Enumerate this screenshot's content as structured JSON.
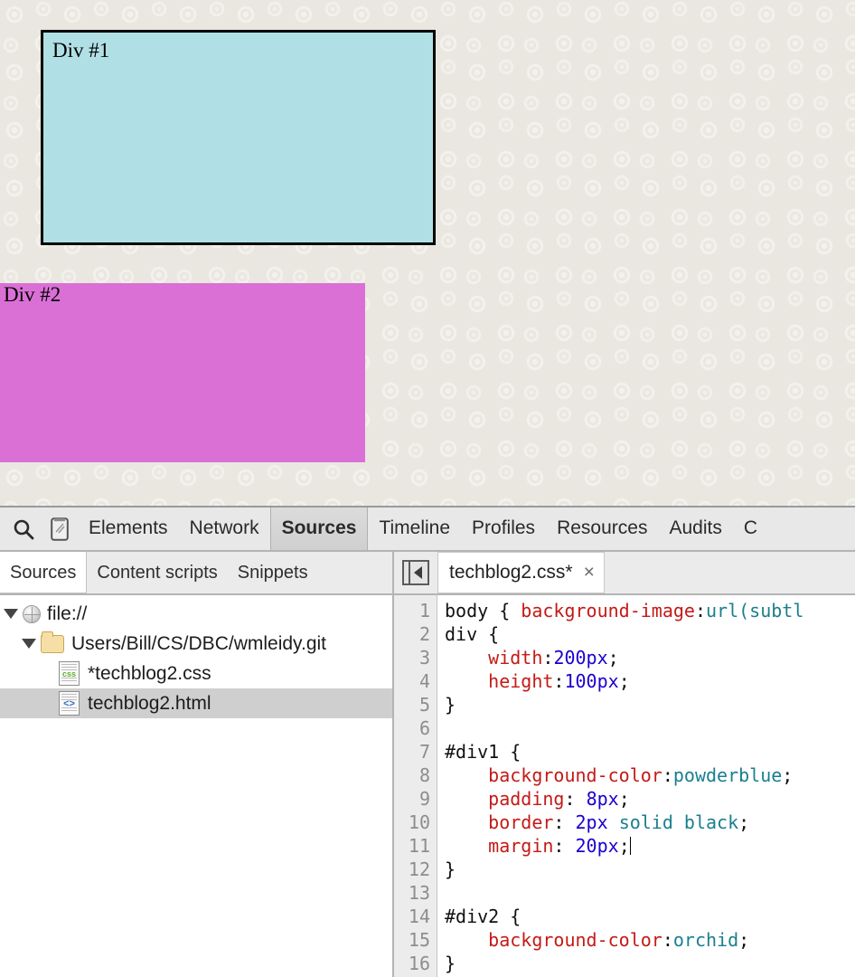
{
  "page": {
    "background_color": "#eae7e1",
    "divs": [
      {
        "id": "div1",
        "label": "Div #1",
        "background_color": "powderblue",
        "hex": "#b0e0e6",
        "border": "2px solid black"
      },
      {
        "id": "div2",
        "label": "Div #2",
        "background_color": "orchid",
        "hex": "#da70d6",
        "border": "none"
      }
    ]
  },
  "devtools": {
    "toolbar": {
      "inspect_icon": "search-icon",
      "device_icon": "device-toggle-icon",
      "tabs": [
        {
          "label": "Elements",
          "selected": false
        },
        {
          "label": "Network",
          "selected": false
        },
        {
          "label": "Sources",
          "selected": true
        },
        {
          "label": "Timeline",
          "selected": false
        },
        {
          "label": "Profiles",
          "selected": false
        },
        {
          "label": "Resources",
          "selected": false
        },
        {
          "label": "Audits",
          "selected": false
        },
        {
          "label": "C",
          "selected": false
        }
      ]
    },
    "navigator": {
      "subtabs": [
        {
          "label": "Sources",
          "selected": true
        },
        {
          "label": "Content scripts",
          "selected": false
        },
        {
          "label": "Snippets",
          "selected": false
        }
      ],
      "tree": [
        {
          "label": "file://",
          "icon": "globe-icon",
          "indent": 0,
          "expanded": true,
          "selected": false
        },
        {
          "label": "Users/Bill/CS/DBC/wmleidy.git",
          "icon": "folder-icon",
          "indent": 1,
          "expanded": true,
          "selected": false
        },
        {
          "label": "*techblog2.css",
          "icon": "css-file-icon",
          "indent": 2,
          "expanded": null,
          "selected": false
        },
        {
          "label": "techblog2.html",
          "icon": "html-file-icon",
          "indent": 2,
          "expanded": null,
          "selected": true
        }
      ]
    },
    "editor": {
      "collapse_icon": "collapse-sidebar-icon",
      "tab_label": "techblog2.css*",
      "tab_close": "×",
      "line_numbers": [
        "1",
        "2",
        "3",
        "4",
        "5",
        "6",
        "7",
        "8",
        "9",
        "10",
        "11",
        "12",
        "13",
        "14",
        "15",
        "16"
      ],
      "lines": [
        [
          {
            "t": "body { ",
            "c": "plain"
          },
          {
            "t": "background-image",
            "c": "prop"
          },
          {
            "t": ":",
            "c": "plain"
          },
          {
            "t": "url(subtl",
            "c": "val"
          }
        ],
        [
          {
            "t": "div {",
            "c": "plain"
          }
        ],
        [
          {
            "t": "    ",
            "c": "plain"
          },
          {
            "t": "width",
            "c": "prop"
          },
          {
            "t": ":",
            "c": "plain"
          },
          {
            "t": "200px",
            "c": "num"
          },
          {
            "t": ";",
            "c": "plain"
          }
        ],
        [
          {
            "t": "    ",
            "c": "plain"
          },
          {
            "t": "height",
            "c": "prop"
          },
          {
            "t": ":",
            "c": "plain"
          },
          {
            "t": "100px",
            "c": "num"
          },
          {
            "t": ";",
            "c": "plain"
          }
        ],
        [
          {
            "t": "}",
            "c": "plain"
          }
        ],
        [],
        [
          {
            "t": "#div1 {",
            "c": "plain"
          }
        ],
        [
          {
            "t": "    ",
            "c": "plain"
          },
          {
            "t": "background-color",
            "c": "prop"
          },
          {
            "t": ":",
            "c": "plain"
          },
          {
            "t": "powderblue",
            "c": "val"
          },
          {
            "t": ";",
            "c": "plain"
          }
        ],
        [
          {
            "t": "    ",
            "c": "plain"
          },
          {
            "t": "padding",
            "c": "prop"
          },
          {
            "t": ": ",
            "c": "plain"
          },
          {
            "t": "8px",
            "c": "num"
          },
          {
            "t": ";",
            "c": "plain"
          }
        ],
        [
          {
            "t": "    ",
            "c": "plain"
          },
          {
            "t": "border",
            "c": "prop"
          },
          {
            "t": ": ",
            "c": "plain"
          },
          {
            "t": "2px",
            "c": "num"
          },
          {
            "t": " ",
            "c": "plain"
          },
          {
            "t": "solid black",
            "c": "val"
          },
          {
            "t": ";",
            "c": "plain"
          }
        ],
        [
          {
            "t": "    ",
            "c": "plain"
          },
          {
            "t": "margin",
            "c": "prop"
          },
          {
            "t": ": ",
            "c": "plain"
          },
          {
            "t": "20px",
            "c": "num"
          },
          {
            "t": ";",
            "c": "plain"
          },
          {
            "t": "|caret|",
            "c": "caret"
          }
        ],
        [
          {
            "t": "}",
            "c": "plain"
          }
        ],
        [],
        [
          {
            "t": "#div2 {",
            "c": "plain"
          }
        ],
        [
          {
            "t": "    ",
            "c": "plain"
          },
          {
            "t": "background-color",
            "c": "prop"
          },
          {
            "t": ":",
            "c": "plain"
          },
          {
            "t": "orchid",
            "c": "val"
          },
          {
            "t": ";",
            "c": "plain"
          }
        ],
        [
          {
            "t": "}",
            "c": "plain"
          }
        ]
      ]
    }
  }
}
